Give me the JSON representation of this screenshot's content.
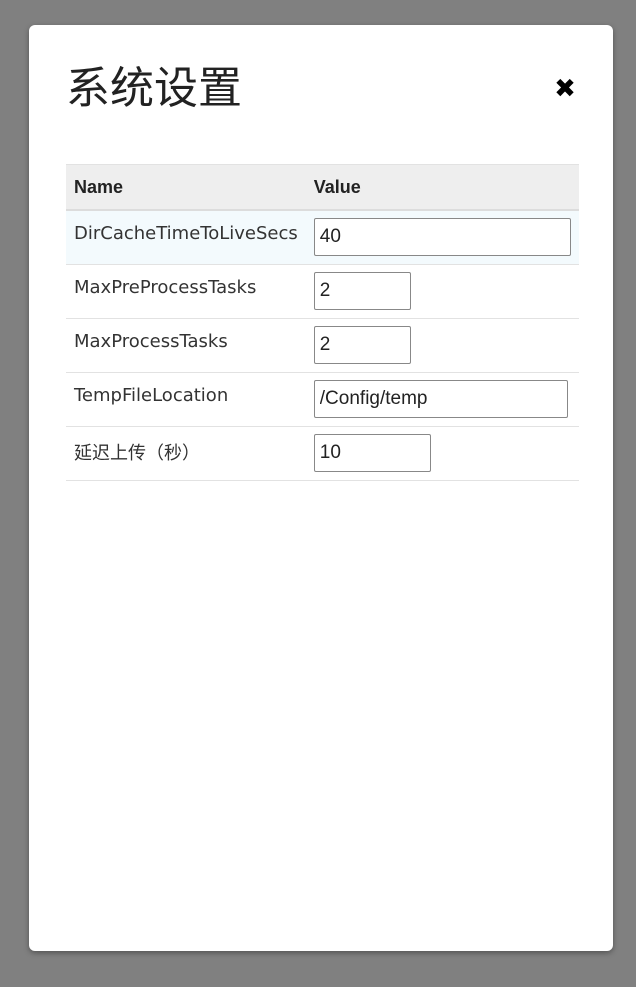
{
  "dialog": {
    "title": "系统设置",
    "close_symbol": "✖"
  },
  "table": {
    "headers": {
      "name": "Name",
      "value": "Value"
    },
    "rows": [
      {
        "name": "DirCacheTimeToLiveSecs",
        "value": "40"
      },
      {
        "name": "MaxPreProcessTasks",
        "value": "2"
      },
      {
        "name": "MaxProcessTasks",
        "value": "2"
      },
      {
        "name": "TempFileLocation",
        "value": "/Config/temp"
      },
      {
        "name": "延迟上传（秒）",
        "value": "10"
      }
    ]
  },
  "colors": {
    "overlay": "#808080",
    "dialog_background": "#ffffff",
    "header_background": "#eeeeee",
    "row_highlight": "#f3fafd"
  },
  "icons": {
    "close": "close-icon"
  }
}
